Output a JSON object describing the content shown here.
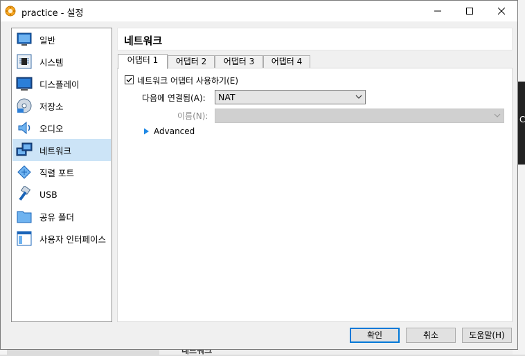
{
  "window": {
    "title": "practice - 설정",
    "controls": {
      "minimize": "minimize",
      "maximize": "maximize",
      "close": "close"
    }
  },
  "sidebar": {
    "items": [
      {
        "label": "일반",
        "icon": "general-icon"
      },
      {
        "label": "시스템",
        "icon": "system-icon"
      },
      {
        "label": "디스플레이",
        "icon": "display-icon"
      },
      {
        "label": "저장소",
        "icon": "storage-icon"
      },
      {
        "label": "오디오",
        "icon": "audio-icon"
      },
      {
        "label": "네트워크",
        "icon": "network-icon",
        "selected": true
      },
      {
        "label": "직렬 포트",
        "icon": "serial-port-icon"
      },
      {
        "label": "USB",
        "icon": "usb-icon"
      },
      {
        "label": "공유 폴더",
        "icon": "shared-folder-icon"
      },
      {
        "label": "사용자 인터페이스",
        "icon": "user-interface-icon"
      }
    ]
  },
  "page": {
    "title": "네트워크"
  },
  "tabs": [
    {
      "label": "어댑터 1",
      "active": true
    },
    {
      "label": "어댑터 2"
    },
    {
      "label": "어댑터 3"
    },
    {
      "label": "어댑터 4"
    }
  ],
  "adapter": {
    "enable_label": "네트워크 어댑터 사용하기(E)",
    "enable_checked": true,
    "attached_label": "다음에 연결됨(A):",
    "attached_value": "NAT",
    "name_label": "이름(N):",
    "name_value": "",
    "advanced_label": "Advanced"
  },
  "buttons": {
    "ok": "확인",
    "cancel": "취소",
    "help": "도움말(H)"
  },
  "background": {
    "right_char": "C",
    "bottom_title": "네트워크"
  },
  "colors": {
    "selection": "#cce4f7",
    "accent": "#0078d7",
    "advanced_arrow": "#1e88e5"
  }
}
